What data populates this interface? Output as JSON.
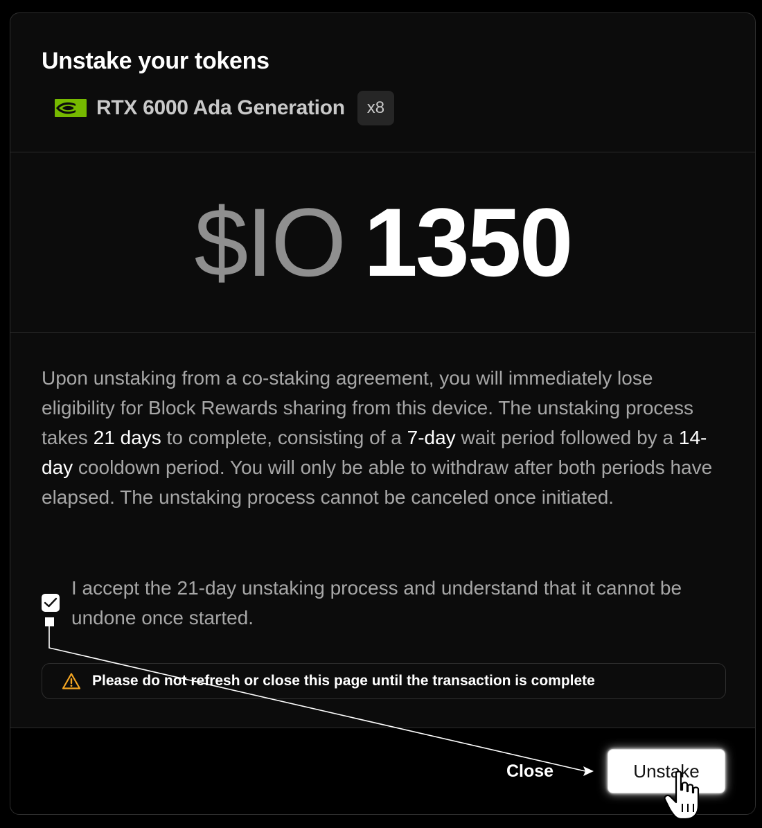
{
  "modal": {
    "title": "Unstake your tokens",
    "device": {
      "icon": "nvidia-logo-icon",
      "name": "RTX 6000 Ada Generation",
      "count": "x8"
    },
    "amount": {
      "currency": "$IO",
      "value": "1350"
    },
    "description": [
      {
        "text": "Upon unstaking from a co-staking agreement, you will immediately lose eligibility for Block Rewards sharing from this device. The unstaking process takes ",
        "highlight": false
      },
      {
        "text": "21 days",
        "highlight": true
      },
      {
        "text": " to complete, consisting of a ",
        "highlight": false
      },
      {
        "text": "7-day",
        "highlight": true
      },
      {
        "text": " wait period followed by a ",
        "highlight": false
      },
      {
        "text": "14-day",
        "highlight": true
      },
      {
        "text": " cooldown period. You will only be able to withdraw after both periods have elapsed. The unstaking process cannot be canceled once initiated.",
        "highlight": false
      }
    ],
    "accept": {
      "label": "I accept the 21-day unstaking process and understand that it cannot be undone once started.",
      "checked": true
    },
    "warning": {
      "icon": "warning-triangle-icon",
      "text": "Please do not refresh or close this page until the transaction is complete"
    },
    "footer": {
      "close_label": "Close",
      "unstake_label": "Unstake"
    }
  },
  "colors": {
    "accent_nvidia": "#76b900",
    "warning": "#f5a623",
    "muted_text": "#a7a7a7",
    "currency_gray": "#8f8f8f"
  },
  "overlay": {
    "annotation": "pointer-arrow-from-checkbox-to-unstake",
    "cursor": "hand-pointer-icon"
  }
}
